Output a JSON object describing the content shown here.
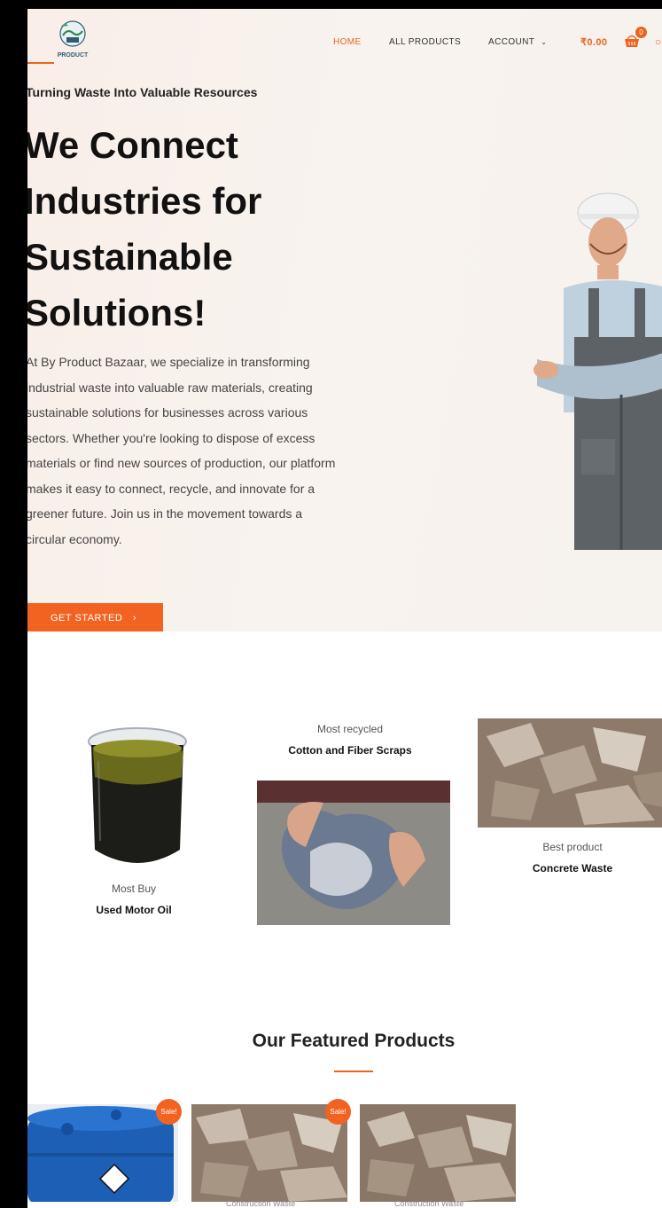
{
  "nav": {
    "logo_text": "PRODUCT",
    "home": "HOME",
    "all_products": "ALL PRODUCTS",
    "account": "ACCOUNT",
    "cart_total": "₹0.00",
    "cart_count": "0"
  },
  "hero": {
    "eyebrow": "Turning Waste Into Valuable Resources",
    "headline": "We Connect Industries for Sustainable Solutions!",
    "intro": "At By Product Bazaar, we specialize in transforming industrial waste into valuable raw materials, creating sustainable solutions for businesses across various sectors. Whether you're looking to dispose of excess materials or find new sources of production, our platform makes it easy to connect, recycle, and innovate for a greener future. Join us in the movement towards a circular economy.",
    "cta": "GET STARTED"
  },
  "categories": [
    {
      "sub": "Most Buy",
      "title": "Used Motor Oil"
    },
    {
      "sub": "Most recycled",
      "title": "Cotton and Fiber Scraps"
    },
    {
      "sub": "Best product",
      "title": "Concrete Waste"
    }
  ],
  "featured": {
    "title": "Our Featured Products",
    "sale_label": "Sale!",
    "products": [
      {
        "category": ""
      },
      {
        "category": "Construction Waste"
      },
      {
        "category": "Construction Waste"
      }
    ]
  },
  "colors": {
    "accent": "#f26322",
    "text": "#111111"
  }
}
